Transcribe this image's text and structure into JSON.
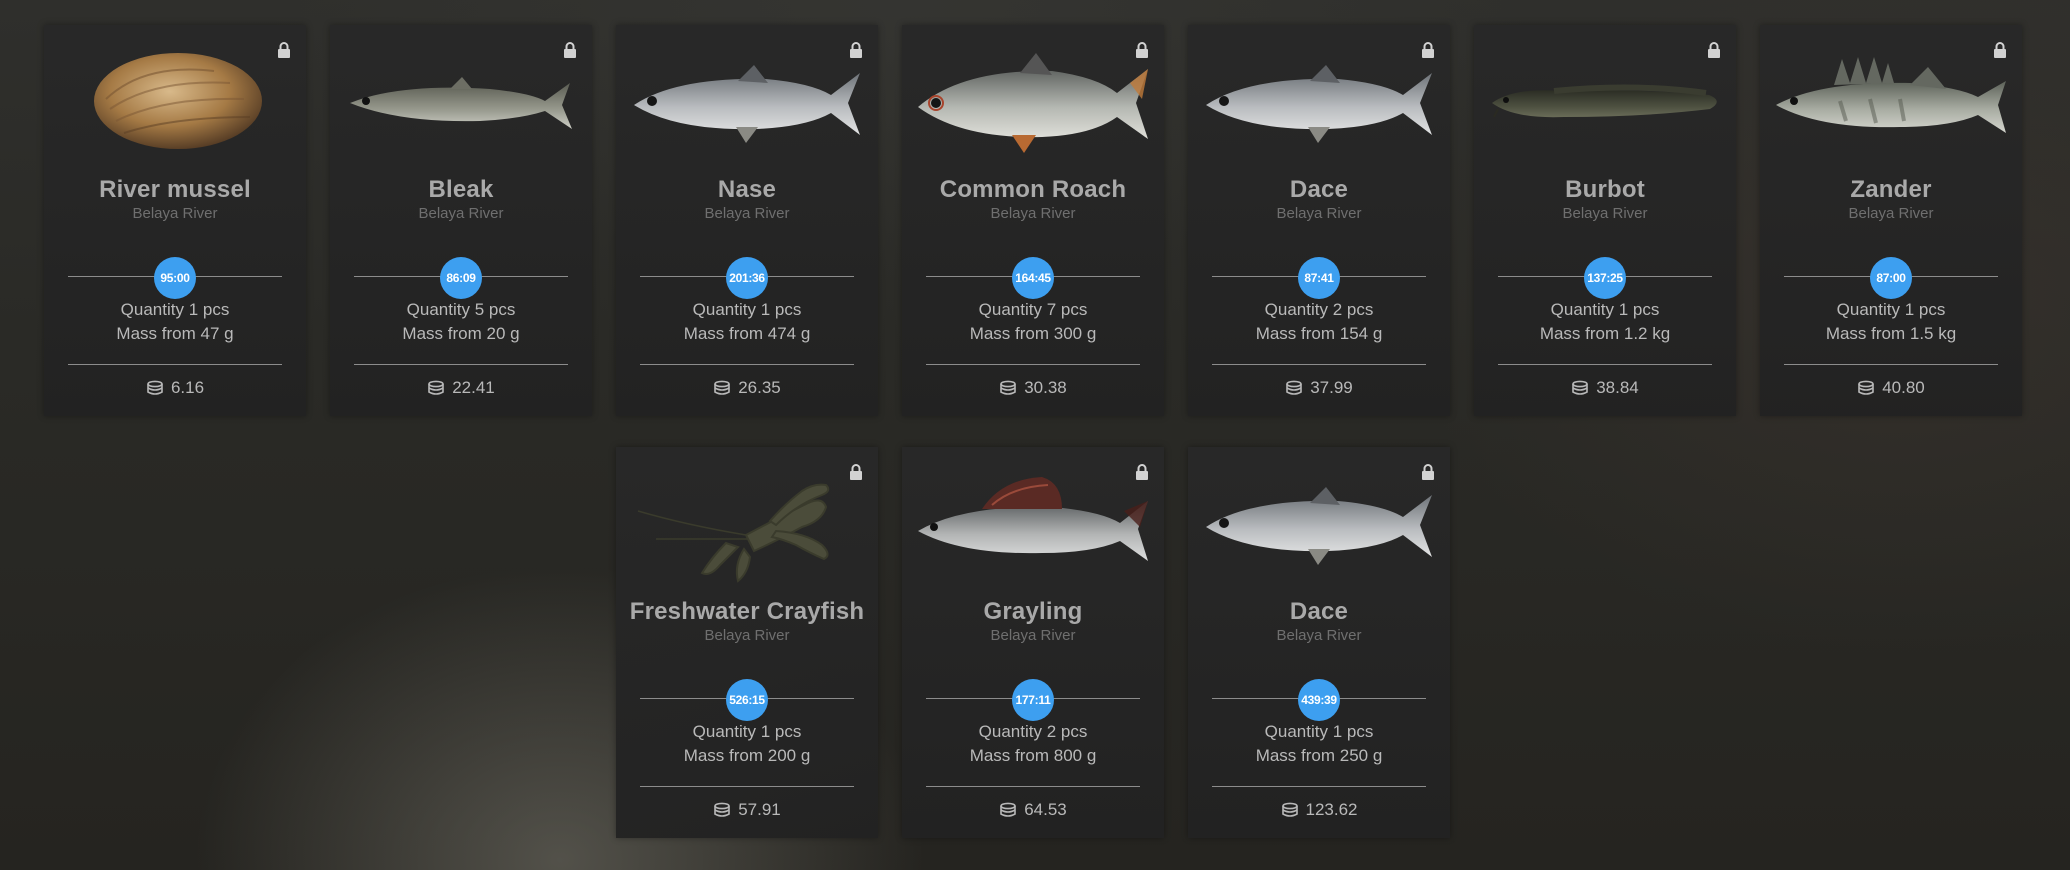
{
  "cards": [
    {
      "name": "River mussel",
      "location": "Belaya River",
      "timer": "95:00",
      "quantity": "Quantity 1 pcs",
      "mass": "Mass from 47 g",
      "price": "6.16",
      "art": "mussel",
      "locked": true
    },
    {
      "name": "Bleak",
      "location": "Belaya River",
      "timer": "86:09",
      "quantity": "Quantity 5 pcs",
      "mass": "Mass from 20 g",
      "price": "22.41",
      "art": "fish-slim",
      "locked": true
    },
    {
      "name": "Nase",
      "location": "Belaya River",
      "timer": "201:36",
      "quantity": "Quantity 1 pcs",
      "mass": "Mass from 474 g",
      "price": "26.35",
      "art": "fish-silver",
      "locked": true
    },
    {
      "name": "Common Roach",
      "location": "Belaya River",
      "timer": "164:45",
      "quantity": "Quantity 7 pcs",
      "mass": "Mass from 300 g",
      "price": "30.38",
      "art": "fish-roach",
      "locked": true
    },
    {
      "name": "Dace",
      "location": "Belaya River",
      "timer": "87:41",
      "quantity": "Quantity 2 pcs",
      "mass": "Mass from 154 g",
      "price": "37.99",
      "art": "fish-silver",
      "locked": true
    },
    {
      "name": "Burbot",
      "location": "Belaya River",
      "timer": "137:25",
      "quantity": "Quantity 1 pcs",
      "mass": "Mass from 1.2 kg",
      "price": "38.84",
      "art": "fish-burbot",
      "locked": true
    },
    {
      "name": "Zander",
      "location": "Belaya River",
      "timer": "87:00",
      "quantity": "Quantity 1 pcs",
      "mass": "Mass from 1.5 kg",
      "price": "40.80",
      "art": "fish-zander",
      "locked": true
    },
    {
      "name": "Freshwater Crayfish",
      "location": "Belaya River",
      "timer": "526:15",
      "quantity": "Quantity 1 pcs",
      "mass": "Mass from 200 g",
      "price": "57.91",
      "art": "crayfish",
      "locked": true
    },
    {
      "name": "Grayling",
      "location": "Belaya River",
      "timer": "177:11",
      "quantity": "Quantity 2 pcs",
      "mass": "Mass from 800 g",
      "price": "64.53",
      "art": "fish-grayling",
      "locked": true
    },
    {
      "name": "Dace",
      "location": "Belaya River",
      "timer": "439:39",
      "quantity": "Quantity 1 pcs",
      "mass": "Mass from 250 g",
      "price": "123.62",
      "art": "fish-silver",
      "locked": true
    }
  ],
  "icons": {
    "lock": "lock-icon",
    "currency": "coin-stack-icon"
  },
  "colors": {
    "timer": "#3d9ff0",
    "card_bg": "#262626",
    "title": "#a9a9a9",
    "subtitle": "#6f6f6f"
  }
}
